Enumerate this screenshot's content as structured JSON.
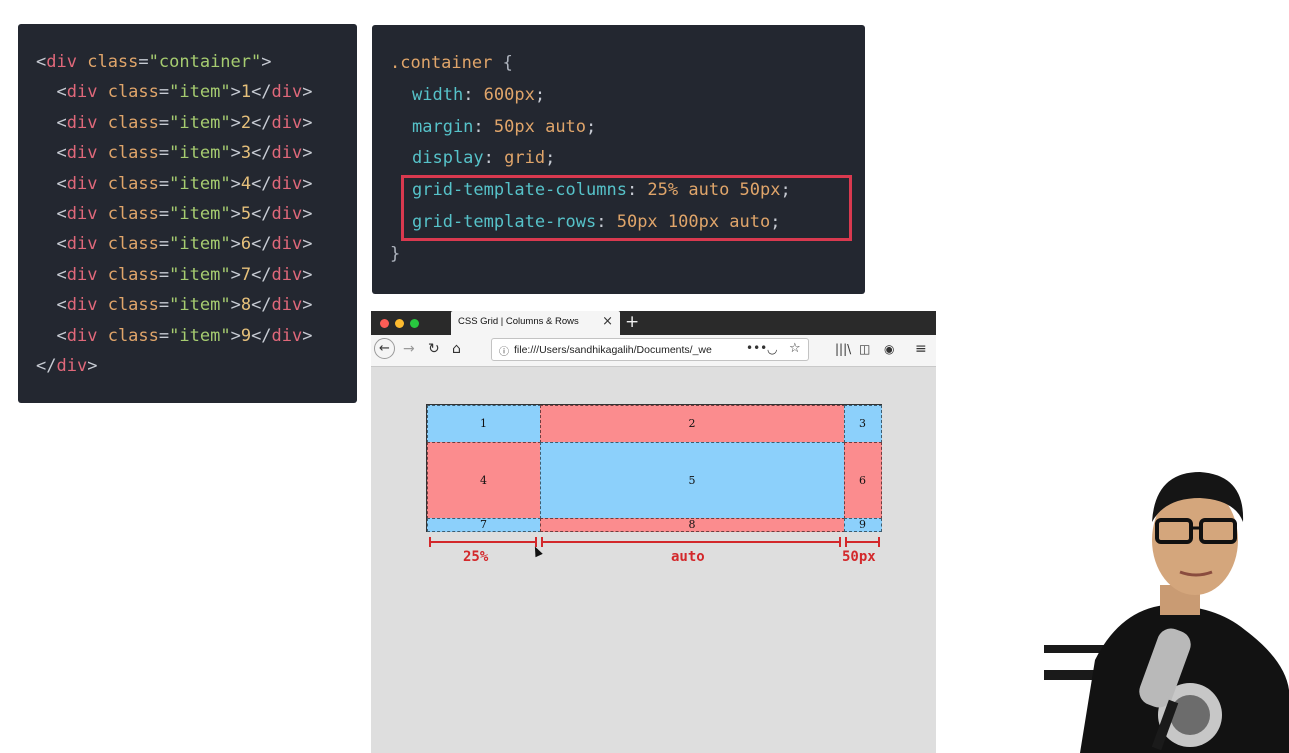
{
  "html_code": {
    "lines": [
      {
        "indent": "",
        "open": "<",
        "tag": "div",
        "attr": "class",
        "eq": "=",
        "value": "\"container\"",
        "close": ">"
      },
      {
        "indent": "  ",
        "open": "<",
        "tag": "div",
        "attr": "class",
        "eq": "=",
        "value": "\"item\"",
        "close": ">",
        "text": "1",
        "end_open": "</",
        "end_tag": "div",
        "end_close": ">"
      },
      {
        "indent": "  ",
        "open": "<",
        "tag": "div",
        "attr": "class",
        "eq": "=",
        "value": "\"item\"",
        "close": ">",
        "text": "2",
        "end_open": "</",
        "end_tag": "div",
        "end_close": ">"
      },
      {
        "indent": "  ",
        "open": "<",
        "tag": "div",
        "attr": "class",
        "eq": "=",
        "value": "\"item\"",
        "close": ">",
        "text": "3",
        "end_open": "</",
        "end_tag": "div",
        "end_close": ">"
      },
      {
        "indent": "  ",
        "open": "<",
        "tag": "div",
        "attr": "class",
        "eq": "=",
        "value": "\"item\"",
        "close": ">",
        "text": "4",
        "end_open": "</",
        "end_tag": "div",
        "end_close": ">"
      },
      {
        "indent": "  ",
        "open": "<",
        "tag": "div",
        "attr": "class",
        "eq": "=",
        "value": "\"item\"",
        "close": ">",
        "text": "5",
        "end_open": "</",
        "end_tag": "div",
        "end_close": ">"
      },
      {
        "indent": "  ",
        "open": "<",
        "tag": "div",
        "attr": "class",
        "eq": "=",
        "value": "\"item\"",
        "close": ">",
        "text": "6",
        "end_open": "</",
        "end_tag": "div",
        "end_close": ">"
      },
      {
        "indent": "  ",
        "open": "<",
        "tag": "div",
        "attr": "class",
        "eq": "=",
        "value": "\"item\"",
        "close": ">",
        "text": "7",
        "end_open": "</",
        "end_tag": "div",
        "end_close": ">"
      },
      {
        "indent": "  ",
        "open": "<",
        "tag": "div",
        "attr": "class",
        "eq": "=",
        "value": "\"item\"",
        "close": ">",
        "text": "8",
        "end_open": "</",
        "end_tag": "div",
        "end_close": ">"
      },
      {
        "indent": "  ",
        "open": "<",
        "tag": "div",
        "attr": "class",
        "eq": "=",
        "value": "\"item\"",
        "close": ">",
        "text": "9",
        "end_open": "</",
        "end_tag": "div",
        "end_close": ">"
      },
      {
        "indent": "",
        "open": "</",
        "tag": "div",
        "close": ">"
      }
    ]
  },
  "css_code": {
    "selector": ".container",
    "open_brace": " {",
    "close_brace": "}",
    "declarations": [
      {
        "prop": "width",
        "value": "600px"
      },
      {
        "prop": "margin",
        "value": "50px auto"
      },
      {
        "prop": "display",
        "value": "grid"
      },
      {
        "prop": "grid-template-columns",
        "value": "25% auto 50px"
      },
      {
        "prop": "grid-template-rows",
        "value": "50px 100px auto"
      }
    ],
    "colon": ": ",
    "semicolon": ";",
    "highlight_color": "#d9394f"
  },
  "browser": {
    "tab_title": "CSS Grid | Columns & Rows",
    "tab_close": "×",
    "new_tab": "+",
    "url": "file:///Users/sandhikagalih/Documents/_we",
    "url_more": "•••",
    "icons": [
      "back-icon",
      "forward-icon",
      "reload-icon",
      "home-icon",
      "info-icon",
      "pocket-icon",
      "star-icon",
      "library-icon",
      "sidebar-icon",
      "account-icon",
      "menu-icon"
    ]
  },
  "grid_demo": {
    "cells": [
      {
        "label": "1",
        "color": "blue"
      },
      {
        "label": "2",
        "color": "red"
      },
      {
        "label": "3",
        "color": "blue"
      },
      {
        "label": "4",
        "color": "red"
      },
      {
        "label": "5",
        "color": "blue"
      },
      {
        "label": "6",
        "color": "red"
      },
      {
        "label": "7",
        "color": "blue"
      },
      {
        "label": "8",
        "color": "red"
      },
      {
        "label": "9",
        "color": "blue"
      }
    ],
    "measures": [
      "25%",
      "auto",
      "50px"
    ],
    "colors": {
      "blue": "#8cd0fb",
      "red": "#fb8c8e",
      "measure": "#d3282b"
    }
  }
}
